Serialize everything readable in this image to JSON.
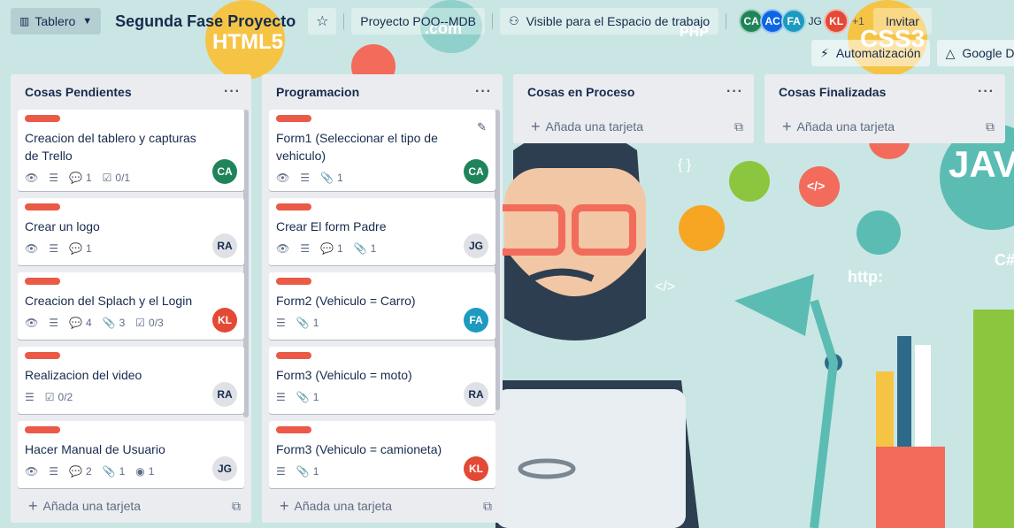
{
  "header": {
    "view_label": "Tablero",
    "board_title": "Segunda Fase Proyecto",
    "workspace": "Proyecto POO--MDB",
    "visibility": "Visible para el Espacio de trabajo",
    "members": [
      {
        "initials": "CA",
        "color": "#1f845a"
      },
      {
        "initials": "AC",
        "color": "#0c66e4"
      },
      {
        "initials": "FA",
        "color": "#1d9ac0"
      },
      {
        "initials": "JG",
        "color": ""
      },
      {
        "initials": "KL",
        "color": "#e34935"
      }
    ],
    "more_members": "+1",
    "invite": "Invitar",
    "automation": "Automatización",
    "google": "Google D"
  },
  "lists": [
    {
      "title": "Cosas Pendientes",
      "add_card": "Añada una tarjeta",
      "cards": [
        {
          "title": "Creacion del tablero y capturas de Trello",
          "watch": true,
          "desc": true,
          "comments": "1",
          "checklist": "0/1",
          "member": "CA",
          "member_color": "#1f845a"
        },
        {
          "title": "Crear un logo",
          "watch": true,
          "desc": true,
          "comments": "1",
          "member": "RA"
        },
        {
          "title": "Creacion del Splach y el Login",
          "watch": true,
          "desc": true,
          "comments": "4",
          "attachments": "3",
          "checklist": "0/3",
          "member": "KL",
          "member_color": "#e34935"
        },
        {
          "title": "Realizacion del video",
          "desc": true,
          "checklist": "0/2",
          "member": "RA"
        },
        {
          "title": "Hacer Manual de Usuario",
          "watch": true,
          "desc": true,
          "comments": "2",
          "attachments": "1",
          "github": "1",
          "member": "JG"
        }
      ]
    },
    {
      "title": "Programacion",
      "add_card": "Añada una tarjeta",
      "cards": [
        {
          "title": "Form1 (Seleccionar el tipo de vehiculo)",
          "watch": true,
          "desc": true,
          "attachments": "1",
          "member": "CA",
          "member_color": "#1f845a",
          "edit": true
        },
        {
          "title": "Crear El form Padre",
          "watch": true,
          "desc": true,
          "comments": "1",
          "attachments": "1",
          "member": "JG"
        },
        {
          "title": "Form2 (Vehiculo = Carro)",
          "desc": true,
          "attachments": "1",
          "member": "FA",
          "member_color": "#1d9ac0"
        },
        {
          "title": "Form3 (Vehiculo = moto)",
          "desc": true,
          "attachments": "1",
          "member": "RA"
        },
        {
          "title": "Form3 (Vehiculo = camioneta)",
          "desc": true,
          "attachments": "1",
          "member": "KL",
          "member_color": "#e34935"
        }
      ]
    },
    {
      "title": "Cosas en Proceso",
      "add_card": "Añada una tarjeta",
      "cards": []
    },
    {
      "title": "Cosas Finalizadas",
      "add_card": "Añada una tarjeta",
      "cards": []
    }
  ],
  "background_text": {
    "html5": "HTML5",
    "com": ".com",
    "php": "PHP",
    "css3": "CSS3",
    "java": "JAV",
    "http": "http:",
    "csharp": "C#",
    "braces": "{ }",
    "tag": "</>",
    "tag2": "</>"
  },
  "colors": {
    "label_red": "#eb5a46",
    "list_bg": "#ebecf0",
    "board_bg": "#c9e6e4"
  }
}
